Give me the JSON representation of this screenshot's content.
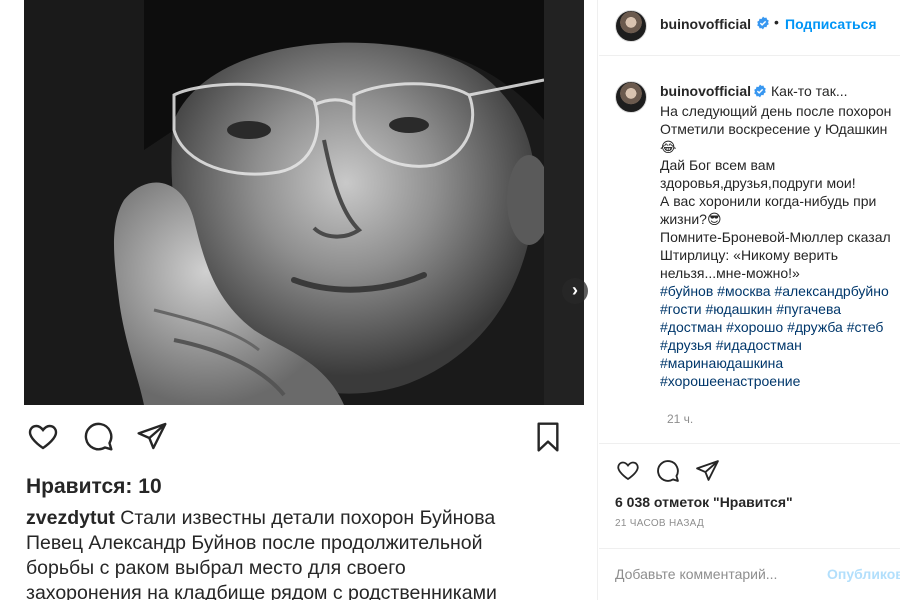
{
  "media": {
    "next_arrow": "›",
    "inner_post": {
      "likes_label": "Нравится: 10",
      "caption_user": "zvezdytut",
      "caption_text": "Стали известны детали похорон Буйнова",
      "caption_lines": [
        "Певец Александр Буйнов после продолжительной",
        "борьбы с раком выбрал место для своего",
        "захоронения на кладбище рядом с родственниками"
      ],
      "icons": [
        "heart-icon",
        "comment-icon",
        "share-icon",
        "bookmark-icon"
      ]
    }
  },
  "header": {
    "username": "buinovofficial",
    "separator": "•",
    "follow_label": "Подписаться"
  },
  "caption": {
    "username": "buinovofficial",
    "first_line": "Как-то так...",
    "lines": [
      "На следующий день после похорон",
      "Отметили воскресение у Юдашкин",
      "😂",
      "Дай Бог всем вам",
      "здоровья,друзья,подруги мои!",
      "А вас хоронили когда-нибудь при",
      "жизни?😎",
      "Помните-Броневой-Мюллер сказал",
      "Штирлицу: «Никому верить",
      "нельзя...мне-можно!»"
    ],
    "hashtag_lines": [
      "#буйнов #москва #александрбуйно",
      "#гости #юдашкин #пугачева",
      "#достман #хорошо #дружба #стеб",
      "#друзья #идадостман",
      "#маринаюдашкина",
      "#хорошеенастроение"
    ],
    "time": "21 ч."
  },
  "actions": {
    "likes": "6 038 отметок \"Нравится\"",
    "time_ago": "21 часов назад"
  },
  "comment_box": {
    "placeholder": "Добавьте комментарий...",
    "publish_label": "Опубликов"
  },
  "colors": {
    "accent": "#0095f6",
    "hashtag": "#00376b",
    "muted": "#8e8e8e",
    "verified": "#3897f0"
  }
}
